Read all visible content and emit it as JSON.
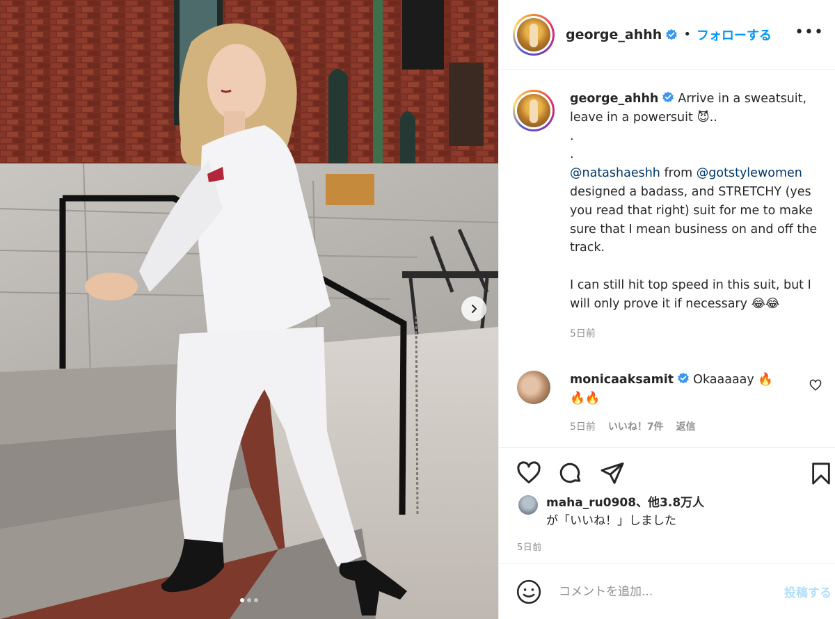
{
  "post": {
    "username": "george_ahhh",
    "follow_label": "フォローする",
    "separator": "•",
    "more_label": "•••"
  },
  "caption": {
    "username": "george_ahhh",
    "line1": "Arrive in a sweatsuit, leave in a powersuit",
    "emoji1": "😈",
    "trail": "..",
    "dot1": ".",
    "dot2": ".",
    "mention1": "@natashaeshh",
    "from_word": "from",
    "mention2": "@gotstylewomen",
    "body": "designed a badass, and STRETCHY (yes you read that right) suit for me to make sure that I mean business on and off the track.",
    "line_last": "I can still hit top speed in this suit, but I will only prove it if necessary",
    "emoji_last": "😂😂",
    "time": "5日前"
  },
  "comment": {
    "username": "monicaaksamit",
    "text": "Okaaaaay",
    "emoji": "🔥",
    "emoji2": "🔥🔥",
    "time": "5日前",
    "likes": "いいね！7件",
    "reply": "返信"
  },
  "likes": {
    "user": "maha_ru0908",
    "others": "、他3.8万人",
    "suffix": "が「いいね！」しました"
  },
  "post_time": "5日前",
  "add_comment": {
    "placeholder": "コメントを追加...",
    "post_label": "投稿する"
  },
  "icons": {
    "verified": "verified-badge-icon",
    "like": "heart-icon",
    "comment": "comment-icon",
    "share": "paper-plane-icon",
    "save": "bookmark-icon",
    "emoji": "smiley-icon",
    "next": "chevron-right-icon"
  },
  "carousel": {
    "count": 3,
    "active_index": 0
  },
  "colors": {
    "accent": "#0095f6",
    "verified": "#3897f0",
    "post_disabled": "#b2dffc"
  }
}
